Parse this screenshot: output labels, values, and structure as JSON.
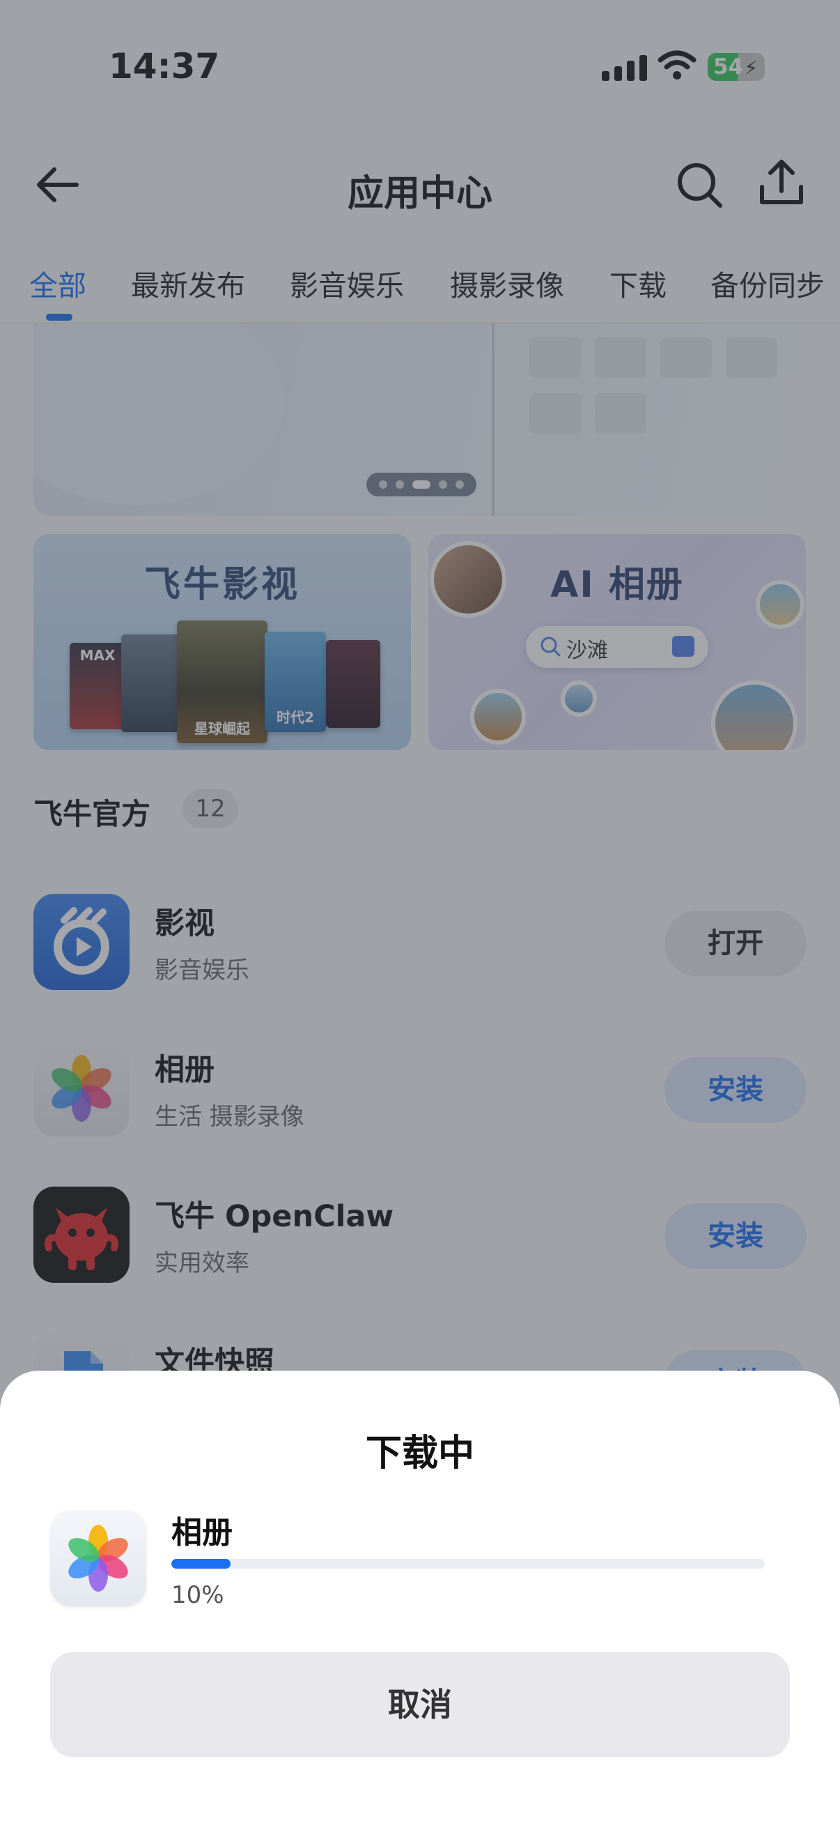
{
  "status_bar": {
    "time": "14:37",
    "battery": "54",
    "battery_level": 0.54
  },
  "header": {
    "title": "应用中心"
  },
  "tabs": [
    {
      "label": "全部",
      "active": true
    },
    {
      "label": "最新发布"
    },
    {
      "label": "影音娱乐"
    },
    {
      "label": "摄影录像"
    },
    {
      "label": "下载"
    },
    {
      "label": "备份同步"
    }
  ],
  "banner": {
    "page_count": 5,
    "active_page": 3
  },
  "promo_cards": [
    {
      "title": "飞牛影视",
      "poster_captions": [
        "MAX",
        "星球崛起",
        "时代2"
      ]
    },
    {
      "title": "AI 相册",
      "search_keyword": "沙滩"
    }
  ],
  "section": {
    "title": "飞牛官方",
    "count": "12"
  },
  "apps": [
    {
      "name": "影视",
      "category": "影音娱乐",
      "action": "打开",
      "icon": "play-video-icon"
    },
    {
      "name": "相册",
      "category": "生活 摄影录像",
      "action": "安装",
      "icon": "photos-flower-icon"
    },
    {
      "name": "飞牛 OpenClaw",
      "category": "实用效率",
      "action": "安装",
      "icon": "red-claw-mascot-icon"
    },
    {
      "name": "文件快照",
      "category": "",
      "action": "安装",
      "icon": "file-snapshot-icon"
    }
  ],
  "download_sheet": {
    "title": "下载中",
    "app_name": "相册",
    "progress": 0.1,
    "progress_text": "10%",
    "cancel_label": "取消"
  },
  "colors": {
    "accent": "#1a6ff2",
    "install_bg": "#dce7fb",
    "open_bg": "#e5e6ea"
  }
}
